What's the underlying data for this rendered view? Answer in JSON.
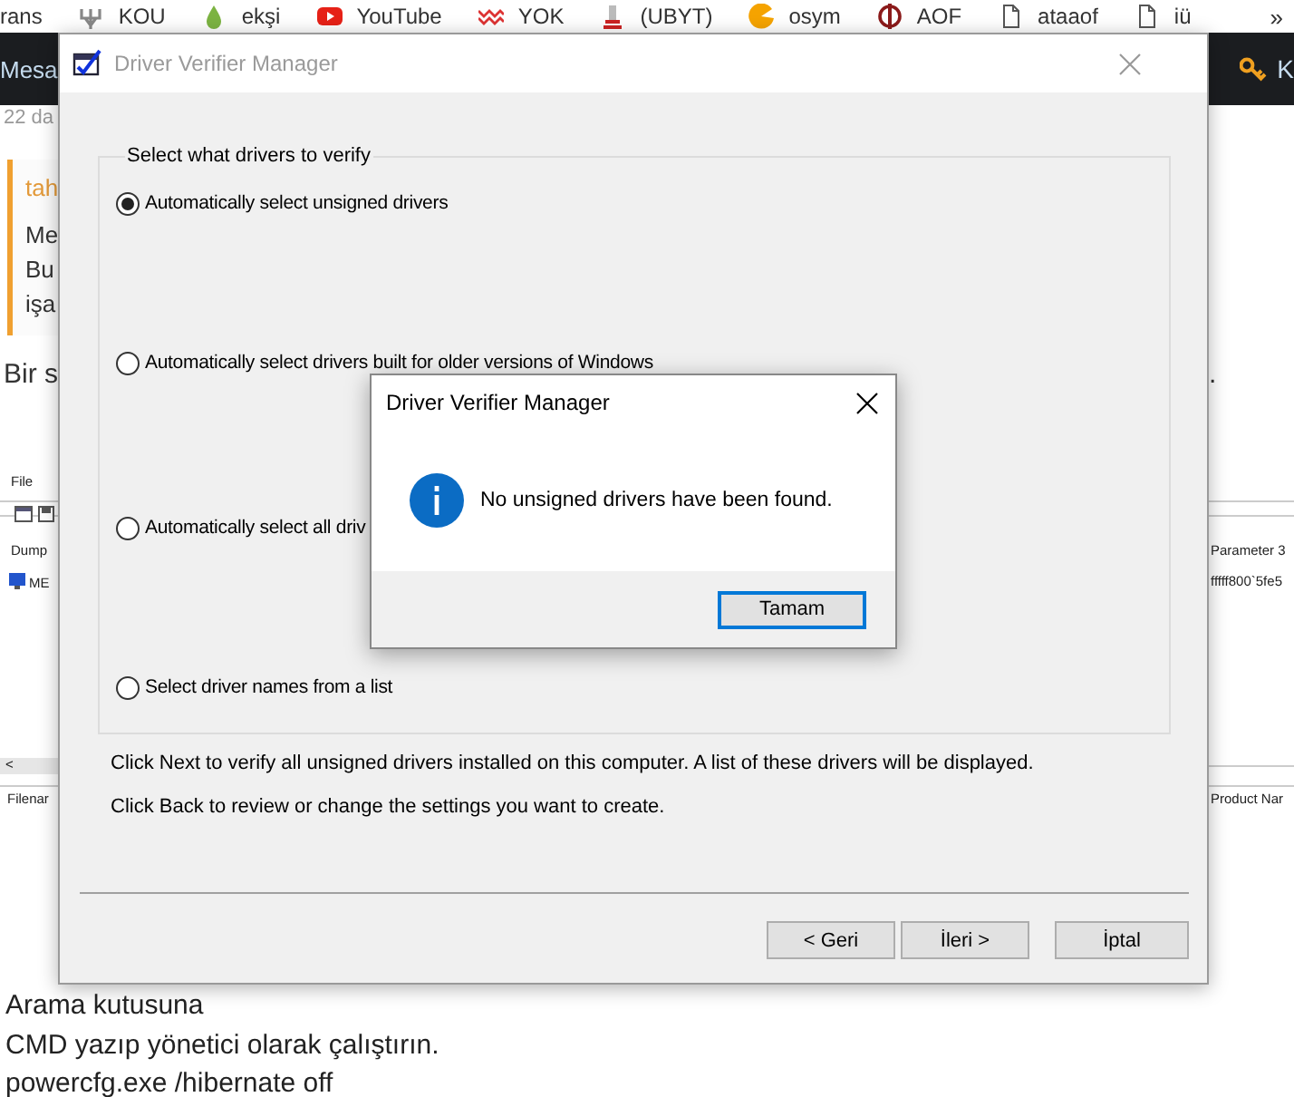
{
  "bookmarks": [
    {
      "label": "rans",
      "kind": "none"
    },
    {
      "label": "KOU",
      "kind": "fork"
    },
    {
      "label": "ekşi",
      "kind": "drop"
    },
    {
      "label": "YouTube",
      "kind": "play"
    },
    {
      "label": "YOK",
      "kind": "zigzag"
    },
    {
      "label": "(UBYT)",
      "kind": "emblem"
    },
    {
      "label": "osym",
      "kind": "pie"
    },
    {
      "label": "AOF",
      "kind": "ring"
    },
    {
      "label": "ataaof",
      "kind": "doc"
    },
    {
      "label": "iü",
      "kind": "doc"
    }
  ],
  "bookmarks_more": "»",
  "site_header": {
    "left_text": "Mesa",
    "right_text": "K"
  },
  "page_left": {
    "date": "22 da",
    "quote_author": "tah",
    "quote_lines": [
      "Me",
      "Bu",
      "işa"
    ],
    "paragraph": "Bir s"
  },
  "page_right": {
    "paragraph_end": "."
  },
  "embedded_screenshot": {
    "menu": "File",
    "column_1": "Dump",
    "row_1": "ME",
    "scroll_arrow": "<",
    "footer_column_1": "Filenar",
    "column_right": "Parameter 3",
    "row_1_right": "fffff800`5fe5",
    "footer_column_right": "Product Nar"
  },
  "page_bottom": [
    "Arama kutusuna",
    "CMD yazıp yönetici olarak çalıştırın.",
    "powercfg.exe /hibernate off"
  ],
  "wizard": {
    "title": "Driver Verifier Manager",
    "active": false,
    "group_label": "Select what drivers to verify",
    "options": [
      {
        "label": "Automatically select unsigned drivers",
        "selected": true
      },
      {
        "label": "Automatically select drivers built for older versions of Windows",
        "selected": false
      },
      {
        "label": "Automatically select all driv",
        "selected": false
      },
      {
        "label": "Select driver names from a list",
        "selected": false
      }
    ],
    "notes": [
      "Click Next to verify all unsigned drivers installed on this computer. A list of these drivers will be displayed.",
      "Click Back to review or change the settings you want to create."
    ],
    "buttons": [
      "< Geri",
      "İleri >",
      "İptal"
    ]
  },
  "message_box": {
    "title": "Driver Verifier Manager",
    "message": "No unsigned drivers have been found.",
    "button": "Tamam"
  }
}
